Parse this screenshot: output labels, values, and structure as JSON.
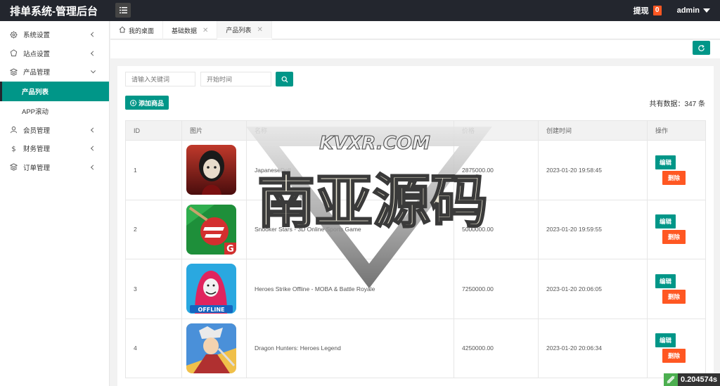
{
  "header": {
    "title": "排单系统-管理后台",
    "withdraw_label": "提现",
    "withdraw_count": "0",
    "user_name": "admin"
  },
  "sidebar": {
    "items": [
      {
        "label": "系统设置",
        "icon": "gear-icon"
      },
      {
        "label": "站点设置",
        "icon": "site-icon"
      },
      {
        "label": "产品管理",
        "icon": "product-icon"
      },
      {
        "label": "会员管理",
        "icon": "user-icon"
      },
      {
        "label": "财务管理",
        "icon": "finance-icon"
      },
      {
        "label": "订单管理",
        "icon": "order-icon"
      }
    ],
    "sub_items": [
      {
        "label": "产品列表",
        "active": true
      },
      {
        "label": "APP滚动",
        "active": false
      }
    ]
  },
  "tabs": [
    {
      "label": "我的桌面",
      "icon": "home-icon"
    },
    {
      "label": "基础数据"
    },
    {
      "label": "产品列表",
      "active": true
    }
  ],
  "search": {
    "keyword_placeholder": "请输入关键词",
    "date_placeholder": "开始时间"
  },
  "add_button": "添加商品",
  "total_text": "共有数据：347 条",
  "table": {
    "columns": [
      "ID",
      "图片",
      "名称",
      "价格",
      "创建时间",
      "操作"
    ],
    "rows": [
      {
        "id": "1",
        "name": "JapaneseDoll",
        "price": "2875000.00",
        "created": "2023-01-20 19:58:45"
      },
      {
        "id": "2",
        "name": "Snooker Stars - 3D Online Sports Game",
        "price": "5000000.00",
        "created": "2023-01-20 19:59:55"
      },
      {
        "id": "3",
        "name": "Heroes Strike Offline - MOBA & Battle Royale",
        "price": "7250000.00",
        "created": "2023-01-20 20:06:05"
      },
      {
        "id": "4",
        "name": "Dragon Hunters: Heroes Legend",
        "price": "4250000.00",
        "created": "2023-01-20 20:06:34"
      }
    ],
    "edit_label": "编辑",
    "delete_label": "删除"
  },
  "watermark": {
    "top_text": "KVXR.COM",
    "main_text": "南亚源码"
  },
  "timer": "0.204574s",
  "colors": {
    "primary": "#009688",
    "danger": "#ff5722",
    "header_bg": "#23262e"
  }
}
